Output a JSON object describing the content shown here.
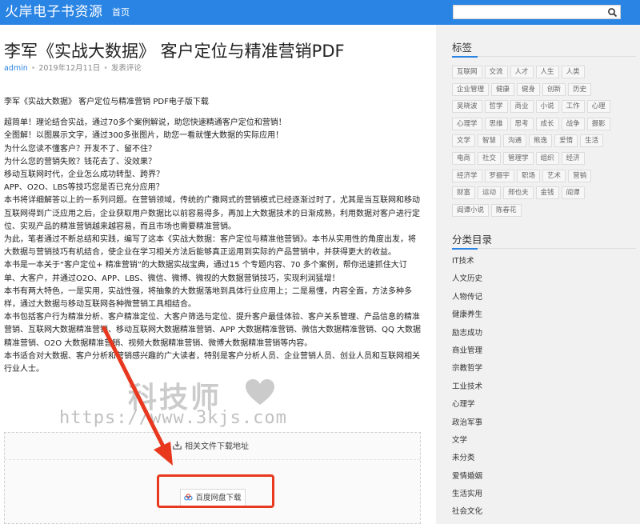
{
  "header": {
    "site_title": "火岸电子书资源",
    "nav_home": "首页",
    "search_placeholder": ""
  },
  "post": {
    "title": "李军《实战大数据》 客户定位与精准营销PDF",
    "author": "admin",
    "date": "2019年12月11日",
    "comment_link": "发表评论",
    "lead": "李军《实战大数据》 客户定位与精准营销 PDF电子版下载",
    "paragraphs": [
      "超简单！理论结合实战，通过70多个案例解说，助您快速精通客户定位和营销！",
      "全图解！以图展示文字，通过300多张图片，助您一看就懂大数据的实际应用！",
      "为什么您读不懂客户？开发不了、留不住？",
      "为什么您的营销失败？钱花去了、没效果？",
      "移动互联网时代，企业怎么成功转型、跨界？",
      "APP、O2O、LBS等技巧您是否已充分应用？",
      "本书将详细解答以上的一系列问题。在营销领域，传统的广撒网式的营销模式已经逐渐过时了，尤其是当互联网和移动互联网得到广泛应用之后，企业获取用户数据比以前容易得多，再加上大数据技术的日渐成熟，利用数据对客户进行定位、实现产品的精准营销越来越容易，而且市场也需要精准营销。",
      "为此，笔者通过不断总结和实践，编写了这本《实战大数据：客户定位与精准他营销》。本书从实用性的角度出发，将大数据与营销技巧有机结合，使企业在学习相关方法后能够真正运用到实际的产品营销中，并获得更大的收益。",
      "本书是一本关于“客户定位+ 精准营销”的大数据实战宝典，通过15 个专题内容、70 多个案例，帮你迅速抓住大订单、大客户，并通过O2O、APP、LBS、微信、微博、微视的大数据营销技巧，实现利润猛增！",
      "本书有两大特色，一是实用，实战性强，将抽象的大数据落地到具体行业应用上；二是易懂，内容全面，方法多种多样，通过大数据与移动互联网各种微营销工具相结合。",
      "本书包括客户行为精准分析、客户精准定位、大客户筛选与定位、提升客户最佳体验、客户关系管理、产品信息的精准营销、互联网大数据精准营销、移动互联网大数据精准营销、APP 大数据精准营销、微信大数据精准营销、QQ 大数据精准营销、O2O 大数据精准营销、视频大数据精准营销、微博大数据精准营销等内容。",
      "本书适合对大数据、客户分析和营销感兴趣的广大读者，特别是客户分析人员、企业营销人员、创业人员和互联网相关行业人士。"
    ]
  },
  "watermark": {
    "text": "科技师",
    "url": "https://www.3kjs.com"
  },
  "download": {
    "header": "相关文件下载地址",
    "button": "百度网盘下载"
  },
  "sidebar": {
    "tags_heading": "标签",
    "tag_rows": [
      [
        "互联网",
        "交流",
        "人才",
        "人生",
        "人类"
      ],
      [
        "企业管理",
        "健康",
        "健身",
        "创新",
        "历史"
      ],
      [
        "吴晓波",
        "哲学",
        "商业",
        "小说",
        "工作",
        "心理"
      ],
      [
        "心理学",
        "思维",
        "思考",
        "成长",
        "战争",
        "摄影"
      ],
      [
        "文学",
        "智慧",
        "沟通",
        "熊逸",
        "爱情",
        "生活"
      ],
      [
        "电商",
        "社交",
        "管理学",
        "组织",
        "经济"
      ],
      [
        "经济学",
        "罗振宇",
        "职场",
        "艺术",
        "营销"
      ],
      [
        "财富",
        "运动",
        "郑也夫",
        "金钱",
        "阎谭"
      ],
      [
        "阎谭小说",
        "陈春花"
      ]
    ],
    "categories_heading": "分类目录",
    "categories": [
      "IT技术",
      "人文历史",
      "人物传记",
      "健康养生",
      "励志成功",
      "商业管理",
      "宗教哲学",
      "工业技术",
      "心理学",
      "政治军事",
      "文学",
      "未分类",
      "爱情婚姻",
      "生活实用",
      "社会文化"
    ]
  },
  "colors": {
    "header_bg": "#2a84e4",
    "link": "#2a84e4",
    "highlight": "#e8391e",
    "sidebar_bg": "#f1f1f1"
  },
  "icons": {
    "search": "search-icon",
    "download": "download-icon",
    "cloud": "cloud-icon"
  }
}
